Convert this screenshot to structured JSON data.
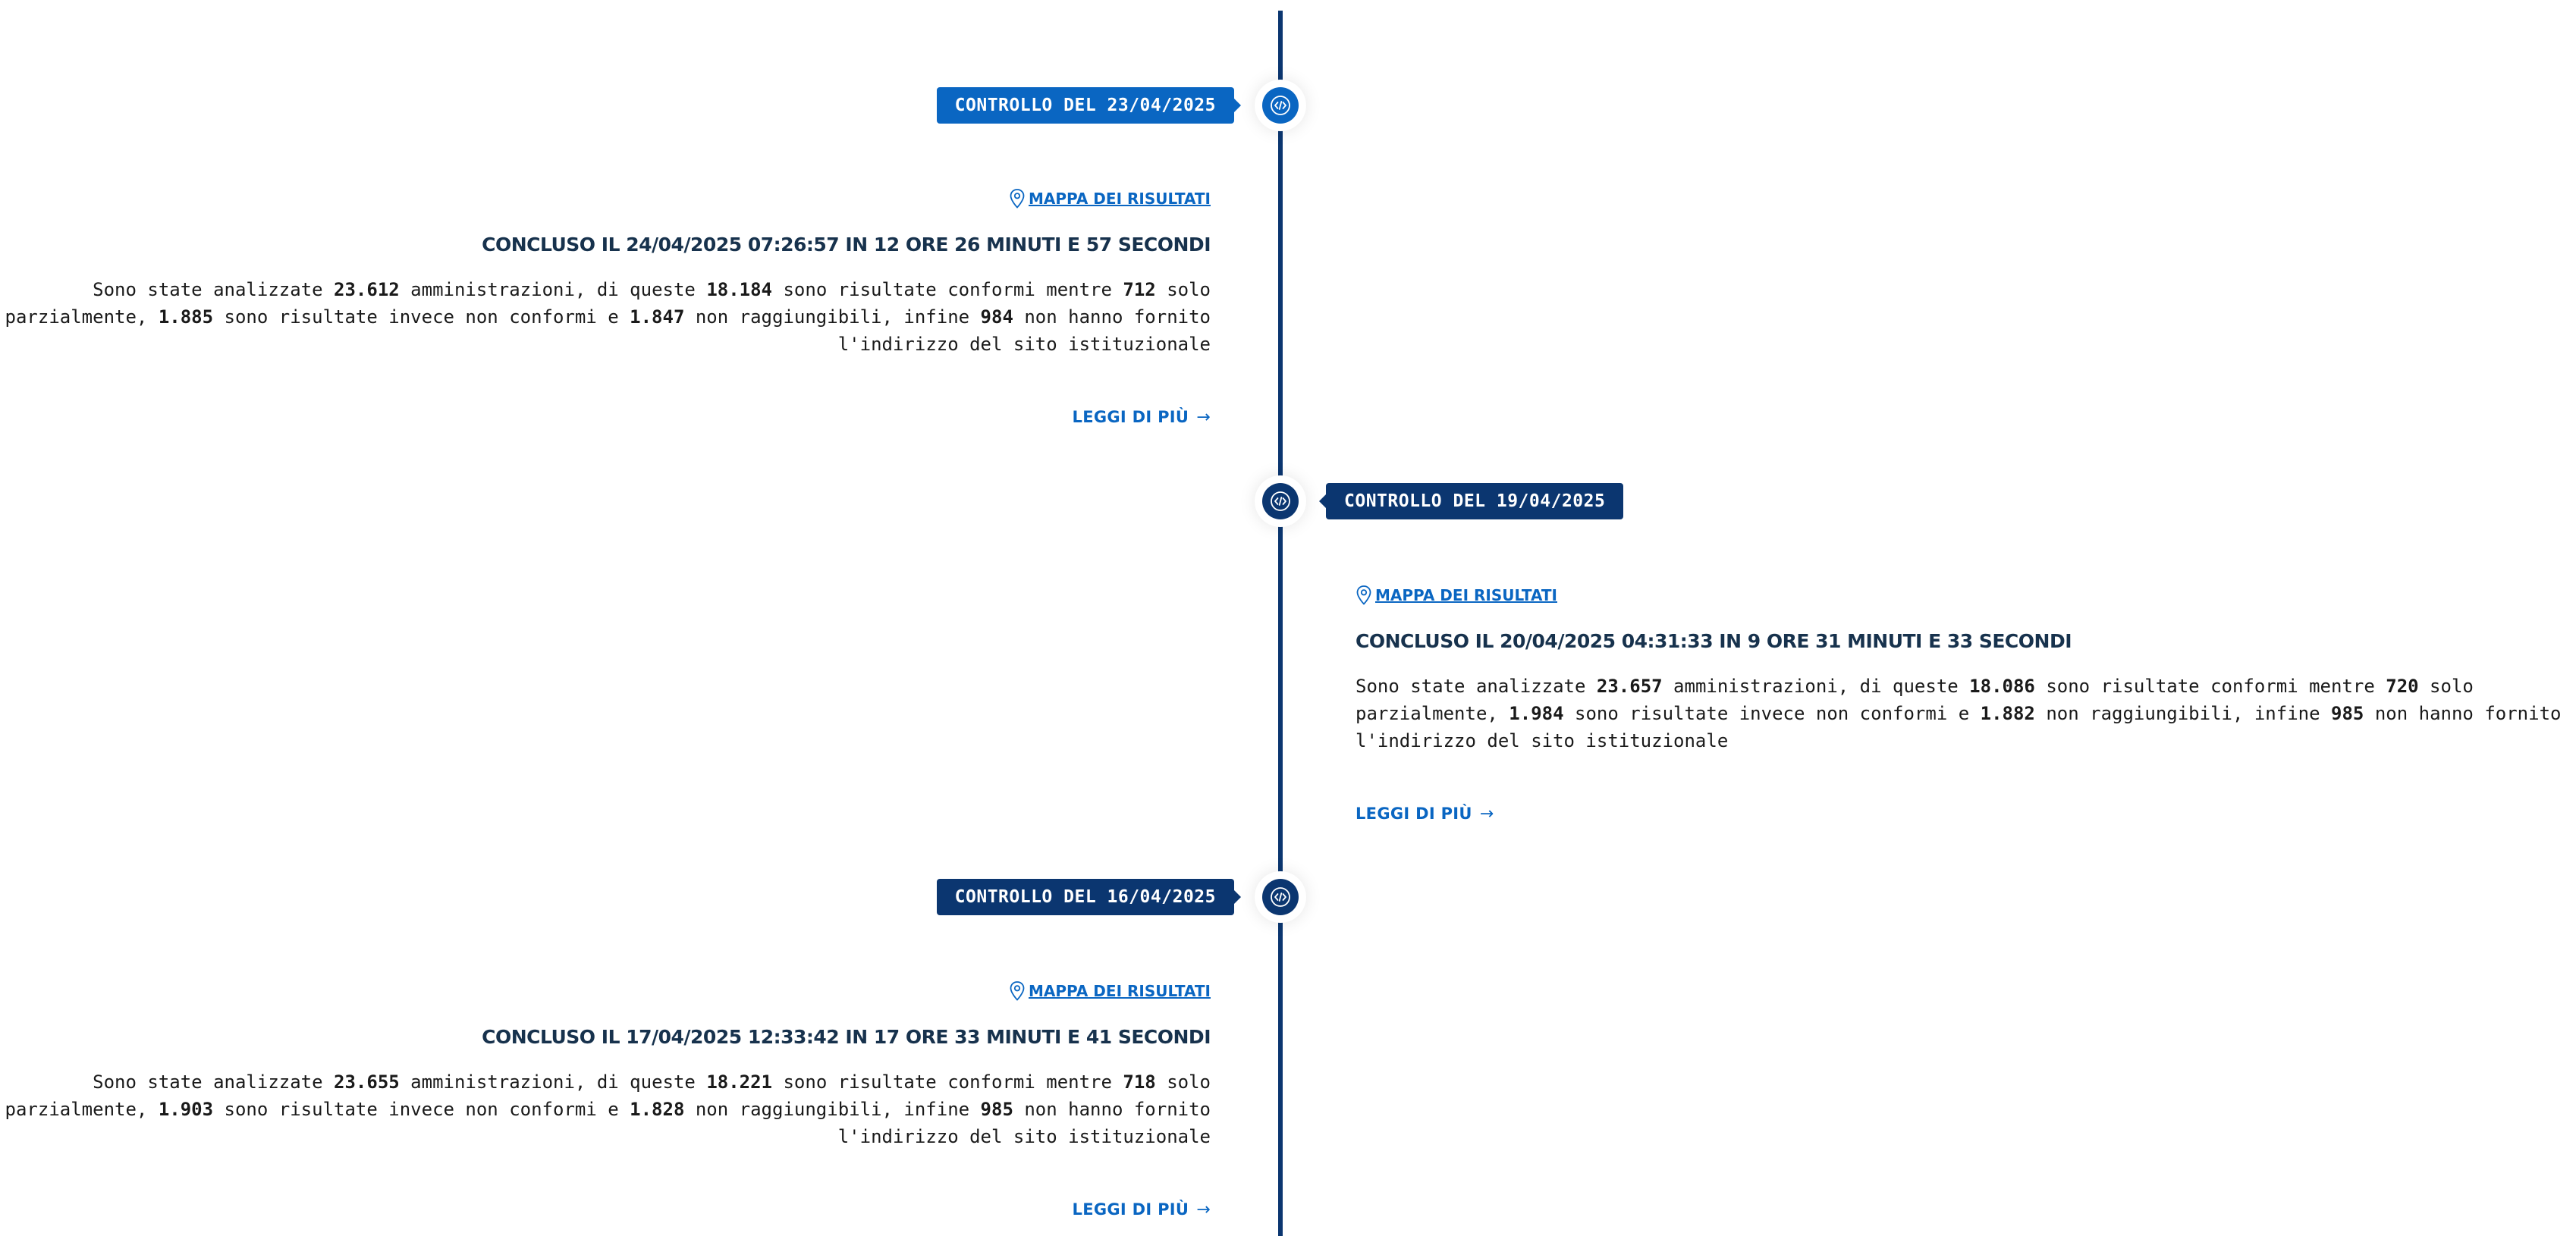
{
  "entries": [
    {
      "label": "CONTROLLO DEL 23/04/2025",
      "map_link": "MAPPA DEI RISULTATI",
      "summary": "CONCLUSO IL 24/04/2025 07:26:57 IN 12 ORE 26 MINUTI E 57 SECONDI",
      "desc": {
        "t1": "Sono state analizzate ",
        "analyzed": "23.612",
        "t2": " amministrazioni, di queste ",
        "compliant": "18.184",
        "t3": " sono risultate conformi mentre ",
        "partial": "712",
        "t4": " solo parzialmente, ",
        "noncompliant": "1.885",
        "t5": " sono risultate invece non conformi e ",
        "unreachable": "1.847",
        "t6": " non raggiungibili, infine ",
        "missing": "984",
        "t7": " non hanno fornito l'indirizzo del sito istituzionale"
      },
      "read_more": "LEGGI DI PIÙ",
      "arrow": "→"
    },
    {
      "label": "CONTROLLO DEL 19/04/2025",
      "map_link": "MAPPA DEI RISULTATI",
      "summary": "CONCLUSO IL 20/04/2025 04:31:33 IN 9 ORE 31 MINUTI E 33 SECONDI",
      "desc": {
        "t1": "Sono state analizzate ",
        "analyzed": "23.657",
        "t2": " amministrazioni, di queste ",
        "compliant": "18.086",
        "t3": " sono risultate conformi mentre ",
        "partial": "720",
        "t4": " solo parzialmente, ",
        "noncompliant": "1.984",
        "t5": " sono risultate invece non conformi e ",
        "unreachable": "1.882",
        "t6": " non raggiungibili, infine ",
        "missing": "985",
        "t7": " non hanno fornito l'indirizzo del sito istituzionale"
      },
      "read_more": "LEGGI DI PIÙ",
      "arrow": "→"
    },
    {
      "label": "CONTROLLO DEL 16/04/2025",
      "map_link": "MAPPA DEI RISULTATI",
      "summary": "CONCLUSO IL 17/04/2025 12:33:42 IN 17 ORE 33 MINUTI E 41 SECONDI",
      "desc": {
        "t1": "Sono state analizzate ",
        "analyzed": "23.655",
        "t2": " amministrazioni, di queste ",
        "compliant": "18.221",
        "t3": " sono risultate conformi mentre ",
        "partial": "718",
        "t4": " solo parzialmente, ",
        "noncompliant": "1.903",
        "t5": " sono risultate invece non conformi e ",
        "unreachable": "1.828",
        "t6": " non raggiungibili, infine ",
        "missing": "985",
        "t7": " non hanno fornito l'indirizzo del sito istituzionale"
      },
      "read_more": "LEGGI DI PIÙ",
      "arrow": "→"
    }
  ],
  "colors": {
    "timeline": "#0b3670",
    "active": "#0a66c2",
    "title": "#17324d"
  },
  "icons": {
    "node": "code-icon",
    "map": "map-pin-icon",
    "read_more": "arrow-right-icon"
  }
}
